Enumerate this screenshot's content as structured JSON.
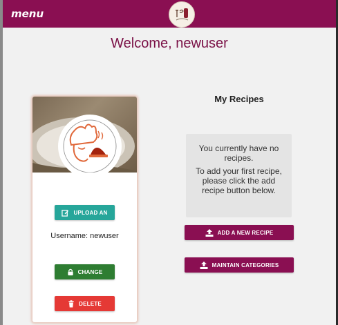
{
  "header": {
    "menu_label": "menu",
    "logo_icon": "food-blog-logo",
    "background_color": "#8a0f52"
  },
  "welcome": {
    "text": "Welcome, newuser"
  },
  "profile": {
    "image_icon": "chef-avatar-icon",
    "upload_label": "UPLOAD AN",
    "username_text": "Username: newuser",
    "change_label": "CHANGE",
    "delete_label": "DELETE"
  },
  "recipes": {
    "title": "My Recipes",
    "empty_line1": "You currently have no recipes.",
    "empty_line2": "To add your first recipe, please click the add recipe button below.",
    "add_label": "ADD A NEW RECIPE",
    "maintain_label": "MAINTAIN CATEGORIES"
  },
  "colors": {
    "brand": "#8a0f52",
    "teal": "#26a69a",
    "green": "#2e7d32",
    "red": "#e53935"
  }
}
